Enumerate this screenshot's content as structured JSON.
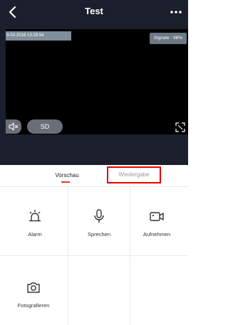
{
  "header": {
    "title": "Test"
  },
  "video": {
    "timestamp": "9-02-2016 13:28:54",
    "signal": "Signale : 96%",
    "quality_label": "SD"
  },
  "tabs": [
    {
      "label": "Vorschau"
    },
    {
      "label": "Wiedergabe"
    }
  ],
  "actions": [
    {
      "label": "Alarm",
      "icon": "alarm-icon"
    },
    {
      "label": "Sprechen",
      "icon": "microphone-icon"
    },
    {
      "label": "Aufnehmen",
      "icon": "video-camera-icon"
    },
    {
      "label": "Fotografieren",
      "icon": "camera-icon"
    }
  ],
  "colors": {
    "header_bg": "#1a1f2b",
    "accent": "#e8352c",
    "highlight_box": "#e60000"
  }
}
